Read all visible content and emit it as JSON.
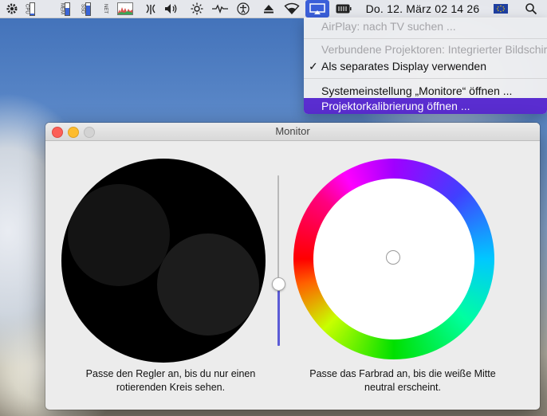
{
  "menubar": {
    "stats": [
      {
        "label": "CPU",
        "level": 0.1
      },
      {
        "label": "MEM",
        "level": 0.55
      },
      {
        "label": "SSD",
        "level": 0.8
      },
      {
        "label": "NET",
        "level": 0.25
      }
    ],
    "date_time": "Do. 12. März  02 14 26",
    "flag": "EU"
  },
  "dropdown": {
    "items": [
      {
        "label": "AirPlay: nach TV suchen ...",
        "state": "disabled"
      },
      {
        "label": "Verbundene Projektoren: Integrierter Bildschirm",
        "state": "disabled"
      },
      {
        "label": "Als separates Display verwenden",
        "state": "checked"
      },
      {
        "label": "Systemeinstellung „Monitore“ öffnen ...",
        "state": "normal"
      },
      {
        "label": "Projektorkalibrierung öffnen ...",
        "state": "highlighted"
      }
    ]
  },
  "window": {
    "title": "Monitor",
    "brightness_slider_level": 0.36,
    "caption_left": [
      "Passe den Regler an, bis du nur einen",
      "rotierenden Kreis sehen."
    ],
    "caption_right": [
      "Passe das Farbrad an, bis die weiße Mitte",
      "neutral erscheint."
    ]
  },
  "colors": {
    "accent": "#5a2dd0",
    "slider_fill": "#5b5bd6"
  }
}
